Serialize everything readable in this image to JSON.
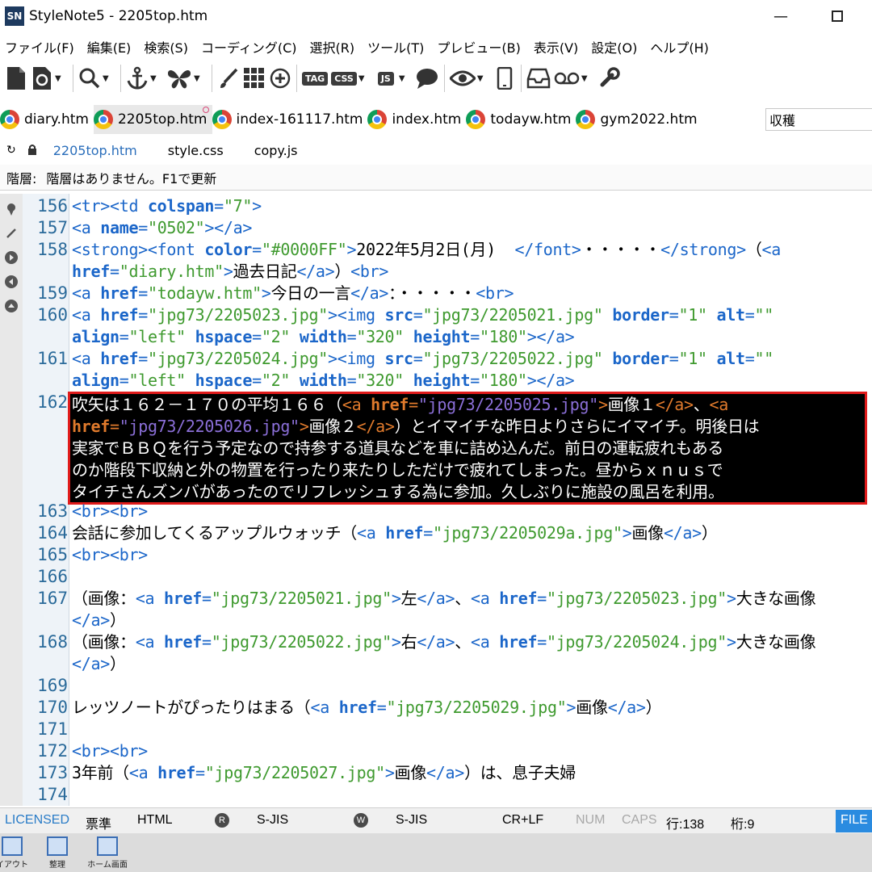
{
  "window": {
    "title": "StyleNote5 - 2205top.htm",
    "app_icon_text": "SN",
    "minimize_glyph": "—"
  },
  "menu": [
    "ファイル(F)",
    "編集(E)",
    "検索(S)",
    "コーディング(C)",
    "選択(R)",
    "ツール(T)",
    "プレビュー(B)",
    "表示(V)",
    "設定(O)",
    "ヘルプ(H)"
  ],
  "toolbar": {
    "tag_label": "TAG",
    "css_label": "CSS",
    "js_label": "JS"
  },
  "tabs": [
    {
      "label": "diary.htm"
    },
    {
      "label": "2205top.htm"
    },
    {
      "label": "index-161117.htm"
    },
    {
      "label": "index.htm"
    },
    {
      "label": "todayw.htm"
    },
    {
      "label": "gym2022.htm"
    }
  ],
  "search": {
    "value": "収穫"
  },
  "related_files": [
    "2205top.htm",
    "style.css",
    "copy.js"
  ],
  "hierarchy": {
    "label": "階層:",
    "text": "階層はありません。F1で更新"
  },
  "line_numbers": [
    "156",
    "157",
    "158",
    "159",
    "160",
    "161",
    "162",
    "163",
    "164",
    "165",
    "166",
    "167",
    "168",
    "169",
    "170",
    "171",
    "172",
    "173",
    "174"
  ],
  "status": {
    "license": "LICENSED",
    "mode": "票準",
    "syntax": "HTML",
    "read_badge": "R",
    "read_enc": "S-JIS",
    "write_badge": "W",
    "write_enc": "S-JIS",
    "newline": "CR+LF",
    "num": "NUM",
    "caps": "CAPS",
    "line": "行:138",
    "col": "桁:9",
    "file": "FILE"
  },
  "taskbar": [
    "イアウト",
    "整理",
    "ホーム画面"
  ]
}
